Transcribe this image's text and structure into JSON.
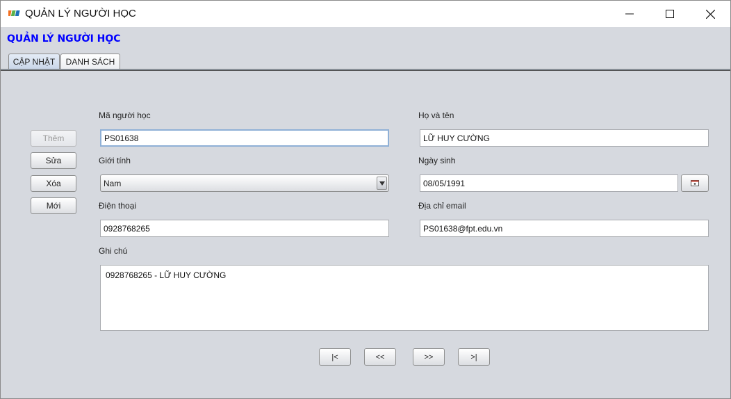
{
  "window": {
    "title": "QUẢN LÝ NGƯỜI HỌC"
  },
  "header": {
    "title": "QUẢN LÝ NGƯỜI HỌC",
    "color": "#0000ff"
  },
  "tabs": [
    {
      "label": "CẬP NHẬT",
      "active": true
    },
    {
      "label": "DANH SÁCH",
      "active": false
    }
  ],
  "actions": {
    "add": {
      "label": "Thêm",
      "enabled": false
    },
    "edit": {
      "label": "Sửa",
      "enabled": true
    },
    "delete": {
      "label": "Xóa",
      "enabled": true
    },
    "new": {
      "label": "Mới",
      "enabled": true
    }
  },
  "form": {
    "student_id": {
      "label": "Mã người học",
      "value": "PS01638"
    },
    "full_name": {
      "label": "Họ và tên",
      "value": "LỮ HUY CƯỜNG"
    },
    "gender": {
      "label": "Giới tính",
      "value": "Nam"
    },
    "birth_date": {
      "label": "Ngày sinh",
      "value": "08/05/1991"
    },
    "phone": {
      "label": "Điện thoại",
      "value": "0928768265"
    },
    "email": {
      "label": "Địa chỉ email",
      "value": "PS01638@fpt.edu.vn"
    },
    "notes": {
      "label": "Ghi chú",
      "value": "0928768265 - LỮ HUY CƯỜNG"
    }
  },
  "navigation": {
    "first": "|<",
    "prev": "<<",
    "next": ">>",
    "last": ">|"
  },
  "icons": {
    "app": "fpt-logo-icon",
    "minimize": "minimize-icon",
    "maximize": "maximize-icon",
    "close": "close-icon",
    "dropdown": "chevron-down-icon",
    "calendar": "calendar-icon"
  }
}
